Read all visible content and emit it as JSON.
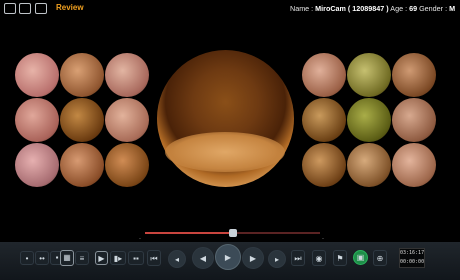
{
  "header": {
    "review_label": "Review",
    "name_label": "Name :",
    "name_value": "MiroCam ( 12089847 )",
    "age_label": "Age :",
    "age_value": "69",
    "gender_label": "Gender :",
    "gender_value": "M"
  },
  "thumbnails_left": [
    {
      "c1": "#e7b3a8",
      "c2": "#b86f6c"
    },
    {
      "c1": "#d9a074",
      "c2": "#8f552f"
    },
    {
      "c1": "#e2b5a2",
      "c2": "#a7675b"
    },
    {
      "c1": "#e0a79a",
      "c2": "#a96259"
    },
    {
      "c1": "#c28844",
      "c2": "#6b3b10"
    },
    {
      "c1": "#e2b29b",
      "c2": "#a86b57"
    },
    {
      "c1": "#e6b0b0",
      "c2": "#a66b70"
    },
    {
      "c1": "#d79a72",
      "c2": "#8a4d28"
    },
    {
      "c1": "#d08c54",
      "c2": "#7a4516"
    }
  ],
  "thumbnails_right": [
    {
      "c1": "#e0b09a",
      "c2": "#9a5f45"
    },
    {
      "c1": "#c6c070",
      "c2": "#6f6a22"
    },
    {
      "c1": "#cf9a73",
      "c2": "#7b4824"
    },
    {
      "c1": "#c99a5c",
      "c2": "#6b4014"
    },
    {
      "c1": "#a9ad48",
      "c2": "#5a5c14"
    },
    {
      "c1": "#d7a98f",
      "c2": "#8e5a40"
    },
    {
      "c1": "#cd995f",
      "c2": "#6e4016"
    },
    {
      "c1": "#d6aa7c",
      "c2": "#7e5128"
    },
    {
      "c1": "#e3b49c",
      "c2": "#9c6549"
    }
  ],
  "timeline": {
    "progress": 0.5,
    "start_label": "-",
    "end_label": "-"
  },
  "controls": {
    "timecode_line1": "03:16:17",
    "timecode_line2": "00:00:00"
  },
  "colors": {
    "accent": "#f0a020",
    "timeline": "#c9453f",
    "capture": "#1e8e49"
  }
}
